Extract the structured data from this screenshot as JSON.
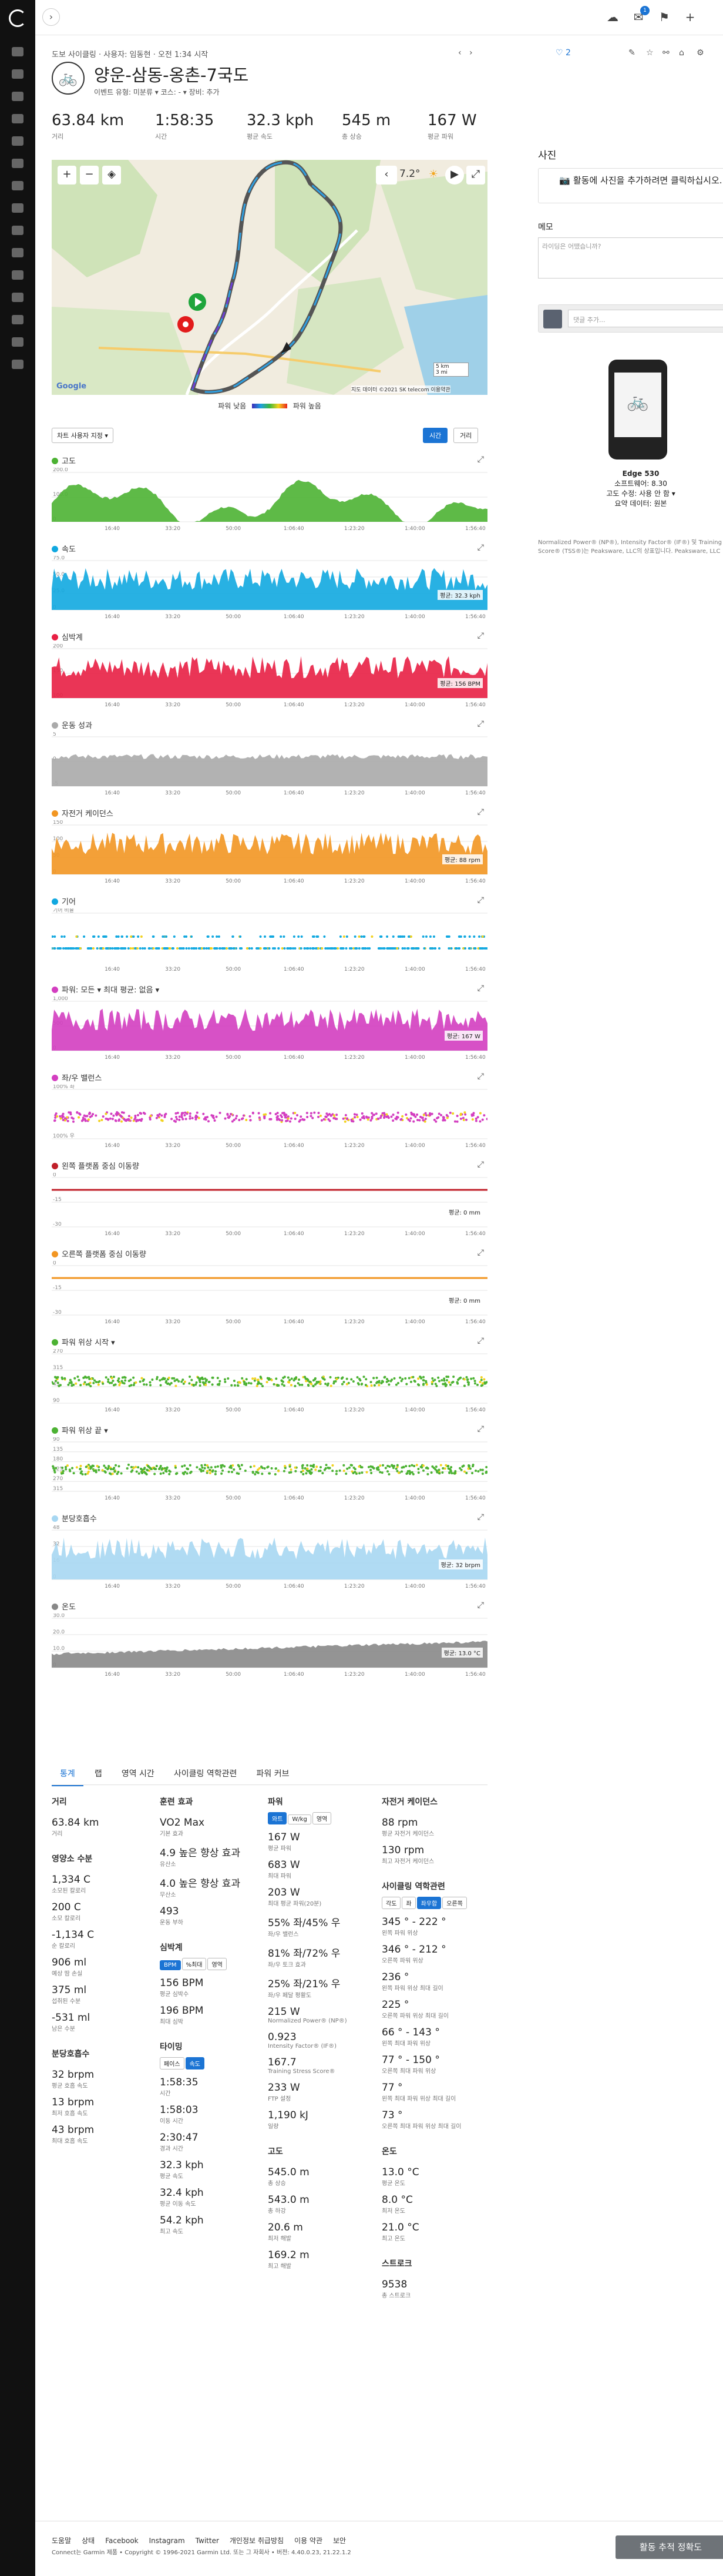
{
  "topbar": {
    "notif_badge": "1"
  },
  "activity": {
    "breadcrumb": "도보 사이클링 · 사용자: 임동현 · 오전 1:34 시작",
    "title": "양운-삼동-옹촌-7국도",
    "subtitle": "이벤트 유형: 미분류 ▾     코스: - ▾     장비: 추가",
    "likes": "2"
  },
  "stats": [
    {
      "value": "63.84 km",
      "label": "거리"
    },
    {
      "value": "1:58:35",
      "label": "시간"
    },
    {
      "value": "32.3 kph",
      "label": "평균 속도"
    },
    {
      "value": "545 m",
      "label": "총 상승"
    },
    {
      "value": "167 W",
      "label": "평균 파워"
    }
  ],
  "map": {
    "temp": "7.2°",
    "scale_km": "5 km",
    "scale_mi": "3 mi",
    "attrib": "지도 데이터 ©2021 SK telecom  이용약관",
    "logo": "Google"
  },
  "legend": {
    "low": "파워 낮음",
    "high": "파워 높음"
  },
  "units": {
    "select": "차트 사용자 지정 ▾",
    "time": "시간",
    "dist": "거리"
  },
  "xticks": [
    "16:40",
    "33:20",
    "50:00",
    "1:06:40",
    "1:23:20",
    "1:40:00",
    "1:56:40"
  ],
  "charts": [
    {
      "id": "elevation",
      "title": "고도",
      "color": "#4cb233",
      "yticks": [
        "200.0",
        "100.0",
        "0"
      ],
      "avg": ""
    },
    {
      "id": "speed",
      "title": "속도",
      "color": "#11a8e0",
      "yticks": [
        "75.0",
        "50.0",
        "25.0",
        "0"
      ],
      "avg": "평균: 32.3 kph"
    },
    {
      "id": "hr",
      "title": "심박계",
      "color": "#e81f44",
      "yticks": [
        "200",
        "150",
        "100"
      ],
      "avg": "평균: 156 BPM"
    },
    {
      "id": "perf",
      "title": "운동 성과",
      "color": "#aaa",
      "yticks": [
        "5",
        "0",
        "-5"
      ],
      "avg": ""
    },
    {
      "id": "cadence",
      "title": "자전거 케이던스",
      "color": "#f29622",
      "yticks": [
        "150",
        "100",
        "50",
        "0"
      ],
      "avg": "평균: 88 rpm"
    },
    {
      "id": "gear",
      "title": "기어",
      "color": "#11a8e0",
      "yticks": [
        "기어 비율"
      ],
      "avg": ""
    },
    {
      "id": "power",
      "title": "파워: 모든 ▾      최대 평균: 없음 ▾",
      "color": "#d33ec0",
      "yticks": [
        "1,000",
        "500",
        "0"
      ],
      "avg": "평균: 167 W"
    },
    {
      "id": "balance",
      "title": "좌/우 밸런스",
      "color": "#d33ec0",
      "yticks": [
        "100% 좌",
        "100% 우"
      ],
      "avg": ""
    },
    {
      "id": "lpco",
      "title": "왼쪽 플랫폼 중심 이동량",
      "color": "#c0202a",
      "yticks": [
        "0",
        "-15",
        "-30"
      ],
      "avg": "평균: 0 mm"
    },
    {
      "id": "rpco",
      "title": "오른쪽 플랫폼 중심 이동량",
      "color": "#f29622",
      "yticks": [
        "0",
        "-15",
        "-30"
      ],
      "avg": "평균: 0 mm"
    },
    {
      "id": "pstart",
      "title": "파워 위상 시작 ▾",
      "color": "#4cb233",
      "yticks": [
        "270",
        "315",
        "45",
        "90"
      ],
      "avg": ""
    },
    {
      "id": "pend",
      "title": "파워 위상 끝 ▾",
      "color": "#4cb233",
      "yticks": [
        "90",
        "135",
        "180",
        "225",
        "270",
        "315"
      ],
      "avg": ""
    },
    {
      "id": "resp",
      "title": "분당호흡수",
      "color": "#a7d7f2",
      "yticks": [
        "48",
        "32",
        "16",
        "0"
      ],
      "avg": "평균: 32 brpm"
    },
    {
      "id": "temp",
      "title": "온도",
      "color": "#888",
      "yticks": [
        "30.0",
        "20.0",
        "10.0",
        "0"
      ],
      "avg": "평균: 13.0 °C"
    }
  ],
  "tabs": [
    "통계",
    "랩",
    "영역 시간",
    "사이클링 역학관련",
    "파워 커브"
  ],
  "stats_detail": {
    "distance": {
      "h": "거리",
      "items": [
        {
          "v": "63.84 km",
          "l": "거리"
        }
      ]
    },
    "calories": {
      "h": "영양소 수분",
      "items": [
        {
          "v": "1,334 C",
          "l": "소모된 칼로리"
        },
        {
          "v": "200 C",
          "l": "소모 칼로리"
        },
        {
          "v": "-1,134 C",
          "l": "순 칼로리"
        },
        {
          "v": "906 ml",
          "l": "예상 땀 손실"
        },
        {
          "v": "375 ml",
          "l": "섭취된 수분"
        },
        {
          "v": "-531 ml",
          "l": "남은 수분"
        }
      ]
    },
    "resp": {
      "h": "분당호흡수",
      "items": [
        {
          "v": "32 brpm",
          "l": "평균 호흡 속도"
        },
        {
          "v": "13 brpm",
          "l": "최저 호흡 속도"
        },
        {
          "v": "43 brpm",
          "l": "최대 호흡 속도"
        }
      ]
    },
    "training": {
      "h": "훈련 효과",
      "items": [
        {
          "v": "VO2 Max",
          "l": "기본 효과"
        },
        {
          "v": "4.9 높은 향상 효과",
          "l": "유산소"
        },
        {
          "v": "4.0 높은 향상 효과",
          "l": "무산소"
        },
        {
          "v": "493",
          "l": "운동 부하"
        }
      ]
    },
    "hr": {
      "h": "심박계",
      "items": [
        {
          "v": "156 BPM",
          "l": "평균 심박수"
        },
        {
          "v": "196 BPM",
          "l": "최대 심박"
        }
      ]
    },
    "timing": {
      "h": "타이밍",
      "items": [
        {
          "v": "1:58:35",
          "l": "시간"
        },
        {
          "v": "1:58:03",
          "l": "이동 시간"
        },
        {
          "v": "2:30:47",
          "l": "경과 시간"
        },
        {
          "v": "32.3 kph",
          "l": "평균 속도"
        },
        {
          "v": "32.4 kph",
          "l": "평균 이동 속도"
        },
        {
          "v": "54.2 kph",
          "l": "최고 속도"
        }
      ]
    },
    "power": {
      "h": "파워",
      "items": [
        {
          "v": "167 W",
          "l": "평균 파워"
        },
        {
          "v": "683 W",
          "l": "최대 파워"
        },
        {
          "v": "203 W",
          "l": "최대 평균 파워(20분)"
        },
        {
          "v": "55% 좌/45% 우",
          "l": "좌/우 밸런스"
        },
        {
          "v": "81% 좌/72% 우",
          "l": "좌/우 토크 효과"
        },
        {
          "v": "25% 좌/21% 우",
          "l": "좌/우 페달 평활도"
        },
        {
          "v": "215 W",
          "l": "Normalized Power® (NP®)"
        },
        {
          "v": "0.923",
          "l": "Intensity Factor® (IF®)"
        },
        {
          "v": "167.7",
          "l": "Training Stress Score®"
        },
        {
          "v": "233 W",
          "l": "FTP 설정"
        },
        {
          "v": "1,190 kJ",
          "l": "일량"
        }
      ]
    },
    "elev": {
      "h": "고도",
      "items": [
        {
          "v": "545.0 m",
          "l": "총 상승"
        },
        {
          "v": "543.0 m",
          "l": "총 하강"
        },
        {
          "v": "20.6 m",
          "l": "최저 해발"
        },
        {
          "v": "169.2 m",
          "l": "최고 해발"
        }
      ]
    },
    "cad": {
      "h": "자전거 케이던스",
      "items": [
        {
          "v": "88 rpm",
          "l": "평균 자전거 케이던스"
        },
        {
          "v": "130 rpm",
          "l": "최고 자전거 케이던스"
        }
      ]
    },
    "dyn": {
      "h": "사이클링 역학관련",
      "items": [
        {
          "v": "345 ° - 222 °",
          "l": "왼쪽 파워 위상"
        },
        {
          "v": "346 ° - 212 °",
          "l": "오른쪽 파워 위상"
        },
        {
          "v": "236 °",
          "l": "왼쪽 파워 위상 최대 길이"
        },
        {
          "v": "225 °",
          "l": "오른쪽 파워 위상 최대 길이"
        },
        {
          "v": "66 ° - 143 °",
          "l": "왼쪽 최대 파워 위상"
        },
        {
          "v": "77 ° - 150 °",
          "l": "오른쪽 최대 파워 위상"
        },
        {
          "v": "77 °",
          "l": "왼쪽 최대 파워 위상 최대 길이"
        },
        {
          "v": "73 °",
          "l": "오른쪽 최대 파워 위상 최대 길이"
        }
      ]
    },
    "temp": {
      "h": "온도",
      "items": [
        {
          "v": "13.0 °C",
          "l": "평균 온도"
        },
        {
          "v": "8.0 °C",
          "l": "최저 온도"
        },
        {
          "v": "21.0 °C",
          "l": "최고 온도"
        }
      ]
    },
    "strokes": {
      "h": "스트로크",
      "items": [
        {
          "v": "9538",
          "l": "총 스트로크"
        }
      ]
    },
    "pills": {
      "hr_a": "BPM",
      "hr_b": "%최대",
      "hr_c": "영역",
      "tm_a": "페이스",
      "tm_b": "속도",
      "pw_a": "와트",
      "pw_b": "W/kg",
      "pw_c": "영역",
      "dy_a": "각도",
      "dy_b": "좌",
      "dy_c": "좌우합",
      "dy_d": "오른쪽"
    }
  },
  "right": {
    "photos_h": "사진",
    "photos_btn": "활동에 사진을 추가하려면 클릭하십시오.",
    "notes_h": "메모",
    "notes_ph": "라이딩은 어땠습니까?",
    "comment_ph": "댓글 추가...",
    "device": "Edge 530",
    "software": "소프트웨어: 8.30",
    "elev_src": "고도 수정: 사용 안 함 ▾",
    "summary": "요약 데이터: 원본",
    "legal": "Normalized Power® (NP®), Intensity Factor® (IF®) 및 Training Stress Score® (TSS®)는 Peaksware, LLC의 상표입니다. Peaksware, LLC"
  },
  "footer": {
    "links": [
      "도움말",
      "상태",
      "Facebook",
      "Instagram",
      "Twitter",
      "개인정보 취급방침",
      "이용 약관",
      "보안"
    ],
    "copy": "Connect는 Garmin 제품 • Copyright © 1996-2021 Garmin Ltd. 또는 그 자회사 • 버전: 4.40.0.23, 21.22.1.2",
    "btn": "활동 추적 정확도"
  }
}
